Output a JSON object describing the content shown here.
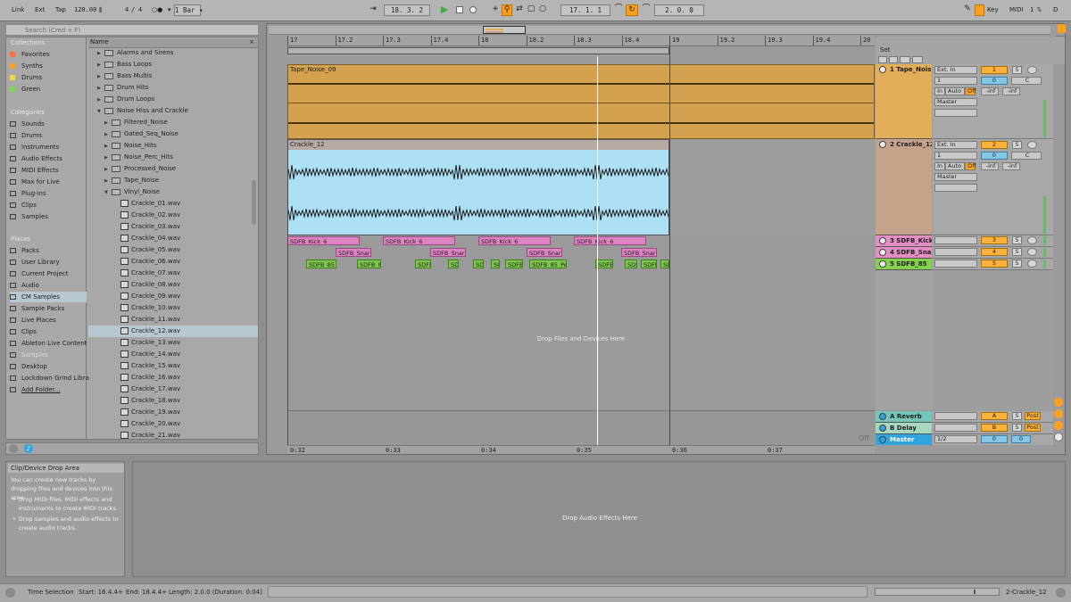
{
  "toolbar": {
    "link": "Link",
    "ext": "Ext",
    "tap": "Tap",
    "tempo": "120.00",
    "meter_num": "4",
    "slash": "/",
    "meter_den": "4",
    "quantize": "1 Bar",
    "position": "18.  3.  2",
    "loop_start": "17.  1.  1",
    "loop_length": "2.  0.  0",
    "key": "Key",
    "midi": "MIDI",
    "cpu": "1 %",
    "d": "D"
  },
  "browser": {
    "search_placeholder": "Search (Cmd + F)",
    "name_header": "Name",
    "collections_title": "Collections",
    "collections": [
      {
        "label": "Favorites",
        "color": "#ff7040"
      },
      {
        "label": "Synths",
        "color": "#ffa11f"
      },
      {
        "label": "Drums",
        "color": "#f2d93c"
      },
      {
        "label": "Green",
        "color": "#7ed955"
      }
    ],
    "categories_title": "Categories",
    "categories": [
      "Sounds",
      "Drums",
      "Instruments",
      "Audio Effects",
      "MIDI Effects",
      "Max for Live",
      "Plug-ins",
      "Clips",
      "Samples"
    ],
    "places_title": "Places",
    "places": [
      "Packs",
      "User Library",
      "Current Project",
      "Audio",
      "CM Samples",
      "Sample Packs",
      "Live Places",
      "Clips",
      "Ableton Live Content",
      "Samples",
      "Desktop",
      "Lockdown Grind Libra",
      "Add Folder..."
    ],
    "folders_top": [
      "Alarms and Sirens",
      "Bass Loops",
      "Bass Multis",
      "Drum Hits",
      "Drum Loops",
      "Noise Hiss and Crackle"
    ],
    "subfolders": [
      "Filtered_Noise",
      "Gated_Seq_Noise",
      "Noise_Hits",
      "Noise_Perc_Hits",
      "Processed_Noise",
      "Tape_Noise",
      "Vinyl_Noise"
    ],
    "files": [
      "Crackle_01.wav",
      "Crackle_02.wav",
      "Crackle_03.wav",
      "Crackle_04.wav",
      "Crackle_05.wav",
      "Crackle_06.wav",
      "Crackle_07.wav",
      "Crackle_08.wav",
      "Crackle_09.wav",
      "Crackle_10.wav",
      "Crackle_11.wav",
      "Crackle_12.wav",
      "Crackle_13.wav",
      "Crackle_14.wav",
      "Crackle_15.wav",
      "Crackle_16.wav",
      "Crackle_17.wav",
      "Crackle_18.wav",
      "Crackle_19.wav",
      "Crackle_20.wav",
      "Crackle_21.wav"
    ]
  },
  "ruler": {
    "bars": [
      "17",
      "17.2",
      "17.3",
      "17.4",
      "18",
      "18.2",
      "18.3",
      "18.4",
      "19",
      "19.2",
      "19.3",
      "19.4",
      "20"
    ],
    "times": [
      "0:32",
      "0:33",
      "0:34",
      "0:35",
      "0:36",
      "0:37"
    ]
  },
  "arrangement": {
    "set_label": "Set",
    "drop_files": "Drop Files and Devices Here",
    "off_label": "Off",
    "clip_tape": "Tape_Noise_09",
    "clip_crackle": "Crackle_12",
    "kick_clips": [
      "SDFB_Kick_6",
      "SDFB_Kick_6",
      "SDFB_Kick_6",
      "SDFB_Kick_6"
    ],
    "snare_clips": [
      "SDFB_Snar",
      "SDFB_Snar",
      "SDFB_Snar",
      "SDFB_Snar"
    ],
    "perc_clips": [
      "SDFB_85",
      "SDFB_8",
      "SDFB",
      "SD",
      "SDI",
      "SI",
      "SDFB",
      "SDFB_85_Pe",
      "SDFB",
      "SDF",
      "SDFI",
      "SD"
    ]
  },
  "tracks": [
    {
      "name": "1 Tape_Nois",
      "color": "#e4ae58",
      "input": "Ext. In",
      "channel": "1",
      "monitor": [
        "In",
        "Auto",
        "Off"
      ],
      "output": "Master",
      "num": "1",
      "vol": "0",
      "pan": "C",
      "send_a": "-inf",
      "send_b": "-inf"
    },
    {
      "name": "2 Crackle_12",
      "color": "#c5a38a",
      "input": "Ext. In",
      "channel": "1",
      "monitor": [
        "In",
        "Auto",
        "Off"
      ],
      "output": "Master",
      "num": "2",
      "vol": "0",
      "pan": "C",
      "send_a": "-inf",
      "send_b": "-inf"
    },
    {
      "name": "3 SDFB_Kick",
      "color": "#e58ec6",
      "num": "3"
    },
    {
      "name": "4 SDFB_Sna",
      "color": "#e58ec6",
      "num": "4"
    },
    {
      "name": "5 SDFB_85",
      "color": "#84d04d",
      "num": "5"
    }
  ],
  "returns": [
    {
      "name": "A Reverb",
      "color": "#74c7ba",
      "letter": "A",
      "post": "Post"
    },
    {
      "name": "B Delay",
      "color": "#a9d8c0",
      "letter": "B",
      "post": "Post"
    }
  ],
  "master": {
    "name": "Master",
    "color": "#31a4e0",
    "out": "1/2",
    "vol": "0",
    "vol2": "0"
  },
  "solo_label": "S",
  "info": {
    "title": "Clip/Device Drop Area",
    "body": "You can create new tracks by dropping files and devices into this area:",
    "bullet1": "Drop MIDI files, MIDI effects and instruments to create MIDI tracks.",
    "bullet2": "Drop samples and audio effects to create audio tracks."
  },
  "detail": {
    "drop_audio": "Drop Audio Effects Here"
  },
  "status": {
    "selection": "Time Selection",
    "start": "Start: 16.4.4+",
    "end": "End: 18.4.4+",
    "length": "Length: 2.0.0 (Duration: 0:04)",
    "clip_name": "2-Crackle_12"
  }
}
